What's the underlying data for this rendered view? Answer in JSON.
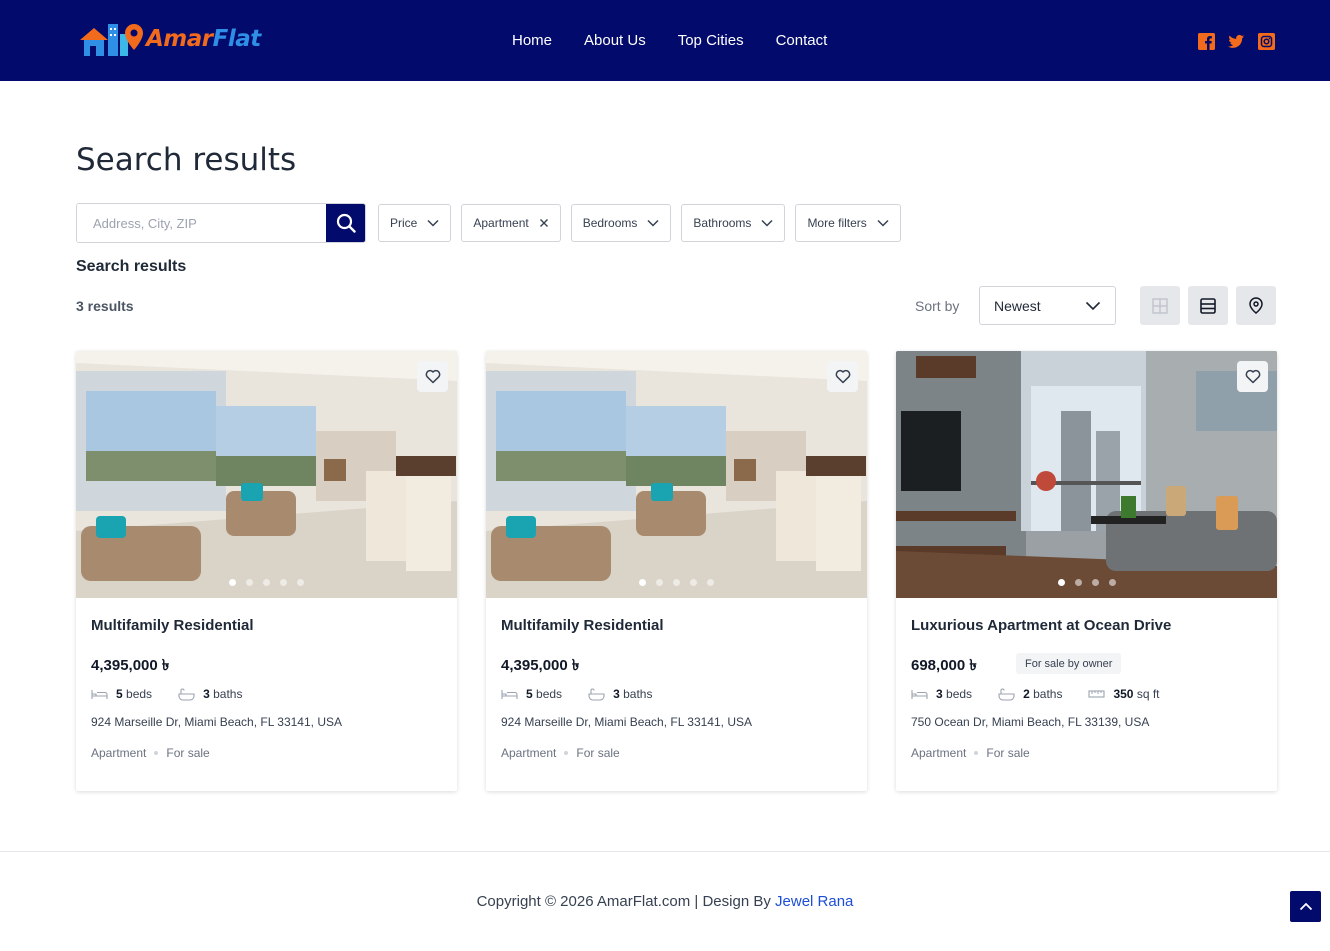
{
  "brand": {
    "name_part1": "Amar",
    "name_part2": "Flat",
    "colors": {
      "primary": "#020a6b",
      "accent": "#f26a1b",
      "accent_blue": "#2f8fe6"
    }
  },
  "nav": {
    "items": [
      {
        "label": "Home"
      },
      {
        "label": "About Us"
      },
      {
        "label": "Top Cities"
      },
      {
        "label": "Contact"
      }
    ]
  },
  "social": [
    {
      "icon": "facebook-icon"
    },
    {
      "icon": "twitter-icon"
    },
    {
      "icon": "instagram-icon"
    }
  ],
  "main": {
    "title": "Search results",
    "search": {
      "placeholder": "Address, City, ZIP",
      "value": ""
    },
    "filters": [
      {
        "label": "Price",
        "icon": "chevron-down-icon"
      },
      {
        "label": "Apartment",
        "icon": "close-icon"
      },
      {
        "label": "Bedrooms",
        "icon": "chevron-down-icon"
      },
      {
        "label": "Bathrooms",
        "icon": "chevron-down-icon"
      },
      {
        "label": "More filters",
        "icon": "chevron-down-icon"
      }
    ],
    "subtitle": "Search results",
    "results_count": "3 results",
    "sort": {
      "label": "Sort by",
      "selected": "Newest"
    },
    "views": [
      {
        "icon": "grid-view-icon"
      },
      {
        "icon": "list-view-icon"
      },
      {
        "icon": "map-pin-icon"
      }
    ]
  },
  "listings": [
    {
      "title": "Multifamily Residential",
      "price": "4,395,000 ৳",
      "badge": "",
      "beds_count": "5",
      "beds_label": "beds",
      "baths_count": "3",
      "baths_label": "baths",
      "area_count": "",
      "area_label": "",
      "address": "924 Marseille Dr, Miami Beach, FL 33141, USA",
      "type": "Apartment",
      "status": "For sale",
      "slides": 5,
      "active_slide": 0
    },
    {
      "title": "Multifamily Residential",
      "price": "4,395,000 ৳",
      "badge": "",
      "beds_count": "5",
      "beds_label": "beds",
      "baths_count": "3",
      "baths_label": "baths",
      "area_count": "",
      "area_label": "",
      "address": "924 Marseille Dr, Miami Beach, FL 33141, USA",
      "type": "Apartment",
      "status": "For sale",
      "slides": 5,
      "active_slide": 0
    },
    {
      "title": "Luxurious Apartment at Ocean Drive",
      "price": "698,000 ৳",
      "badge": "For sale by owner",
      "beds_count": "3",
      "beds_label": "beds",
      "baths_count": "2",
      "baths_label": "baths",
      "area_count": "350",
      "area_label": "sq ft",
      "address": "750 Ocean Dr, Miami Beach, FL 33139, USA",
      "type": "Apartment",
      "status": "For sale",
      "slides": 4,
      "active_slide": 0
    }
  ],
  "footer": {
    "text": "Copyright © 2026 AmarFlat.com | Design By",
    "author": "Jewel Rana"
  }
}
